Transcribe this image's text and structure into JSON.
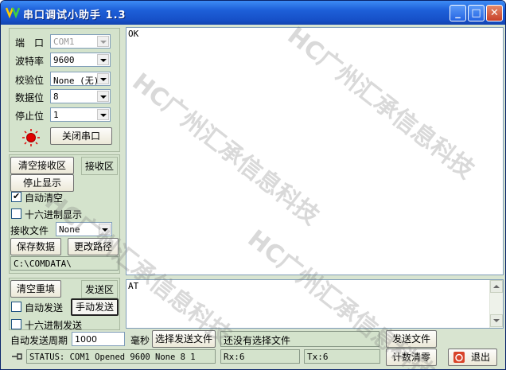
{
  "window": {
    "title": "串口调试小助手 1.3",
    "minimize": "_",
    "maximize": "□",
    "close": "✕"
  },
  "settings": {
    "port_label": "端　口",
    "port_value": "COM1",
    "baud_label": "波特率",
    "baud_value": "9600",
    "parity_label": "校验位",
    "parity_value": "None (无)",
    "databits_label": "数据位",
    "databits_value": "8",
    "stopbits_label": "停止位",
    "stopbits_value": "1",
    "close_port_button": "关闭串口",
    "led_color": "#e00000"
  },
  "receive": {
    "clear_button": "清空接收区",
    "area_label": "接收区",
    "stop_display_button": "停止显示",
    "auto_clear_label": "自动清空",
    "auto_clear_checked": true,
    "hex_display_label": "十六进制显示",
    "hex_display_checked": false,
    "file_label": "接收文件",
    "file_value": "None",
    "save_button": "保存数据",
    "change_path_button": "更改路径",
    "path": "C:\\COMDATA\\",
    "content": "OK"
  },
  "send": {
    "clear_button": "清空重填",
    "area_label": "发送区",
    "auto_send_label": "自动发送",
    "auto_send_checked": false,
    "manual_send_button": "手动发送",
    "hex_send_label": "十六进制发送",
    "hex_send_checked": false,
    "period_label": "自动发送周期",
    "period_value": "1000",
    "ms_label": "毫秒",
    "select_file_button": "选择发送文件",
    "file_status": "还没有选择文件",
    "send_file_button": "发送文件",
    "content": "AT"
  },
  "status": {
    "text": "STATUS: COM1 Opened 9600 None  8 1",
    "rx": "Rx:6",
    "tx": "Tx:6",
    "counter_clear_button": "计数清零",
    "exit_button": "退出"
  },
  "watermark": "HC广州汇承信息科技"
}
